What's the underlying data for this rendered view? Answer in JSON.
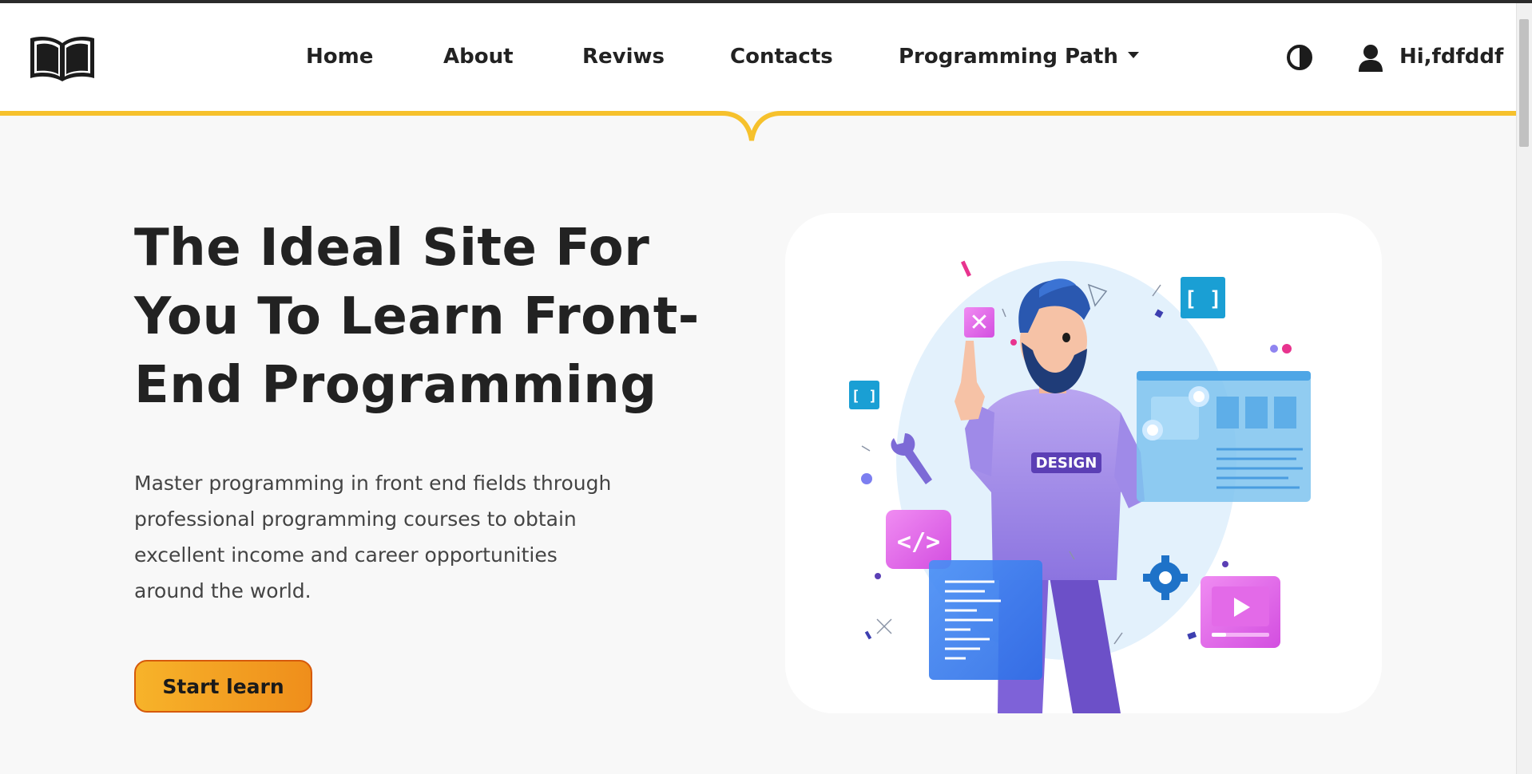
{
  "header": {
    "nav": [
      {
        "id": "home",
        "label": "Home"
      },
      {
        "id": "about",
        "label": "About"
      },
      {
        "id": "reviews",
        "label": "Reviws"
      },
      {
        "id": "contacts",
        "label": "Contacts"
      },
      {
        "id": "programming-path",
        "label": "Programming Path",
        "has_dropdown": true
      }
    ],
    "theme_toggle_icon": "contrast-icon",
    "user_icon": "user-icon",
    "user_greeting": "Hi,fdfddf",
    "logo_icon": "open-book-icon",
    "accent_color": "#f6c12c"
  },
  "hero": {
    "title": "The Ideal Site For You To Learn Front-End Programming",
    "description": "Master programming in front end fields through professional programming courses to obtain excellent income and career opportunities around the world.",
    "cta_label": "Start learn",
    "cta_gradient": [
      "#f7b32a",
      "#ef8e1b"
    ],
    "illustration": {
      "shirt_text": "DESIGN",
      "code_tag": "</>",
      "bracket_text": "[ ]",
      "close_glyph": "✕"
    }
  }
}
